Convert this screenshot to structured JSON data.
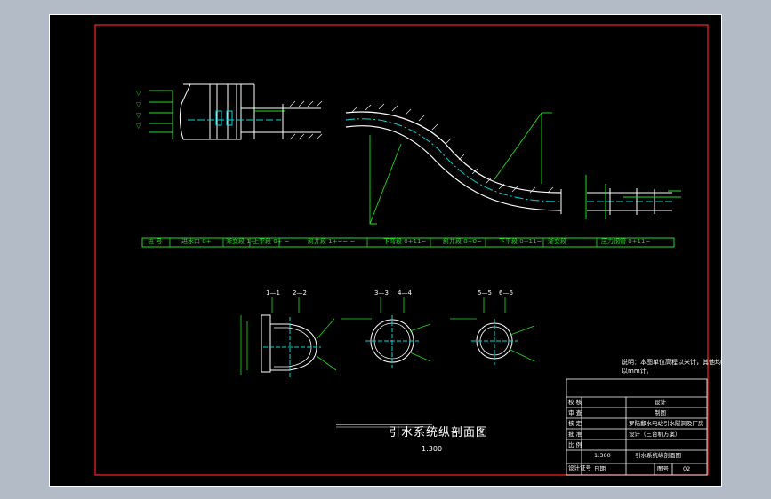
{
  "colors": {
    "viewport_bg": "#b3bcc6",
    "sheet_bg": "#000000",
    "frame_red": "#ff2222",
    "outline_white": "#ffffff",
    "annotation_green": "#22dd22",
    "centerline_cyan": "#00d8d8"
  },
  "drawing": {
    "title": "引水系统纵剖面图",
    "scale": "1:300",
    "note": "说明：本图单位高程以米计，其他均以mm计。"
  },
  "profile_table": {
    "cells": [
      "桩 号",
      "进水口 0+",
      "渐变段 1+",
      "上平段 0+ ~",
      "斜井段 1+~~ ~",
      "下弯段 0+11~",
      "斜井段 0+0~",
      "下平段 0+11~",
      "渐变段 ",
      "压力钢管 0+11~"
    ]
  },
  "sections": [
    {
      "id": "s1",
      "labels": [
        "1—1",
        "2—2"
      ]
    },
    {
      "id": "s2",
      "labels": [
        "3—3",
        "4—4"
      ]
    },
    {
      "id": "s3",
      "labels": [
        "5—5",
        "6—6"
      ]
    }
  ],
  "title_block": {
    "rows": [
      {
        "left": "校  核",
        "right": "设计"
      },
      {
        "left": "审  查",
        "right": "制图"
      },
      {
        "left": "核  定",
        "right": "罗陆鄱水电站引水隧洞及厂房"
      },
      {
        "left": "批  准",
        "right": "设计（三台机方案）"
      },
      {
        "left": "比  例",
        "right": ""
      },
      {
        "left": "设计证号",
        "right": ""
      }
    ],
    "drawing_name": "引水系统纵剖面图",
    "scale_value": "1:300",
    "date_label": "日期",
    "sheet_no_label": "图号",
    "sheet_no": "02"
  }
}
